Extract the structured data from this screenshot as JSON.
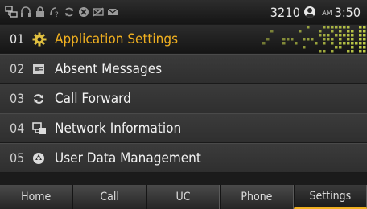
{
  "status": {
    "icons": [
      "network-icon",
      "headset-icon",
      "lock-icon",
      "dnd-icon",
      "forward-icon",
      "missed-call-icon",
      "no-mail-icon",
      "message-icon"
    ],
    "extension": "3210",
    "ampm": "AM",
    "time": "3:50"
  },
  "menu": {
    "items": [
      {
        "number": "01",
        "label": "Application Settings",
        "icon": "gear-icon"
      },
      {
        "number": "02",
        "label": "Absent Messages",
        "icon": "message-card-icon"
      },
      {
        "number": "03",
        "label": "Call Forward",
        "icon": "forward-arrows-icon"
      },
      {
        "number": "04",
        "label": "Network Information",
        "icon": "network-info-icon"
      },
      {
        "number": "05",
        "label": "User Data Management",
        "icon": "user-data-icon"
      }
    ],
    "selected_index": 0
  },
  "softkeys": {
    "items": [
      "Home",
      "Call",
      "UC",
      "Phone",
      "Settings"
    ],
    "active_index": 4
  },
  "colors": {
    "accent": "#f0b020",
    "matrix": "#c8d64a"
  }
}
